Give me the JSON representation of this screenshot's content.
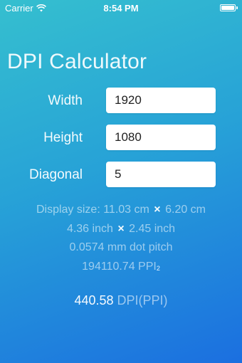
{
  "status_bar": {
    "carrier": "Carrier",
    "wifi_icon": "wifi-icon",
    "time": "8:54 PM",
    "battery_icon": "battery-icon"
  },
  "app": {
    "title": "DPI Calculator"
  },
  "fields": {
    "width": {
      "label": "Width",
      "value": "1920"
    },
    "height": {
      "label": "Height",
      "value": "1080"
    },
    "diagonal": {
      "label": "Diagonal",
      "value": "5"
    }
  },
  "results": {
    "display_size_prefix": "Display size: ",
    "display_size_cm_w": "11.03 cm",
    "display_size_cm_h": "6.20 cm",
    "display_size_inch_w": "4.36 inch",
    "display_size_inch_h": "2.45 inch",
    "times_symbol": "×",
    "dot_pitch": "0.0574 mm dot pitch",
    "pixel_count": "194110.74 PPI",
    "pixel_count_sup": "2",
    "dpi_value": "440.58",
    "dpi_unit": "DPI(PPI)"
  },
  "colors": {
    "gradient_start": "#35bfcf",
    "gradient_end": "#1b6fe0"
  }
}
